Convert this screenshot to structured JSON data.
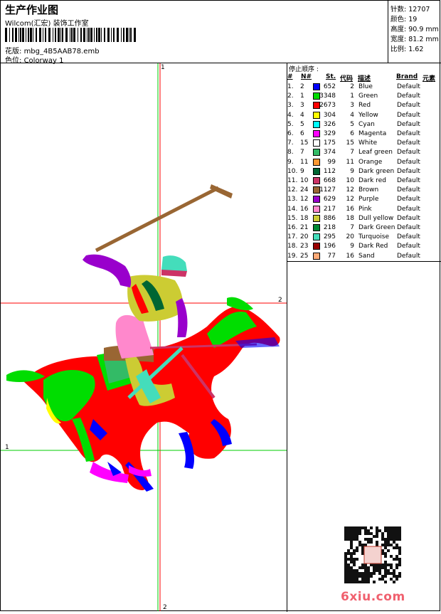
{
  "header": {
    "title": "生产作业图",
    "company": "Wilcom(汇宏) 装饰工作室",
    "design_label": "花版:",
    "design_file": "mbg_4B5AAB78.emb",
    "colorway_label": "色位:",
    "colorway": "Colorway 1"
  },
  "stats": {
    "stitches": "针数: 12707",
    "colors": "颜色: 19",
    "height": "高度: 90.9 mm",
    "width": "宽度: 81.2 mm",
    "scale": "比例: 1.62"
  },
  "guides": {
    "v1": "1",
    "h2": "2",
    "h1": "1",
    "v2": "2"
  },
  "table": {
    "caption": "停止顺序 :",
    "headers": {
      "num": "#",
      "needle": "N#",
      "st": "St.",
      "code": "代码",
      "desc": "描述",
      "brand": "Brand",
      "element": "元素"
    },
    "rows": [
      {
        "num": "1.",
        "needle": "2",
        "color": "#0000ff",
        "st": "652",
        "code": "2",
        "desc": "Blue",
        "brand": "Default"
      },
      {
        "num": "2.",
        "needle": "1",
        "color": "#00dd00",
        "st": "3348",
        "code": "1",
        "desc": "Green",
        "brand": "Default"
      },
      {
        "num": "3.",
        "needle": "3",
        "color": "#ff0000",
        "st": "2673",
        "code": "3",
        "desc": "Red",
        "brand": "Default"
      },
      {
        "num": "4.",
        "needle": "4",
        "color": "#ffff00",
        "st": "304",
        "code": "4",
        "desc": "Yellow",
        "brand": "Default"
      },
      {
        "num": "5.",
        "needle": "5",
        "color": "#00ffff",
        "st": "326",
        "code": "5",
        "desc": "Cyan",
        "brand": "Default"
      },
      {
        "num": "6.",
        "needle": "6",
        "color": "#ff00ff",
        "st": "329",
        "code": "6",
        "desc": "Magenta",
        "brand": "Default"
      },
      {
        "num": "7.",
        "needle": "15",
        "color": "#ffffff",
        "st": "175",
        "code": "15",
        "desc": "White",
        "brand": "Default"
      },
      {
        "num": "8.",
        "needle": "7",
        "color": "#33bb66",
        "st": "374",
        "code": "7",
        "desc": "Leaf green",
        "brand": "Default"
      },
      {
        "num": "9.",
        "needle": "11",
        "color": "#ff9933",
        "st": "99",
        "code": "11",
        "desc": "Orange",
        "brand": "Default"
      },
      {
        "num": "10.",
        "needle": "9",
        "color": "#006633",
        "st": "112",
        "code": "9",
        "desc": "Dark green",
        "brand": "Default"
      },
      {
        "num": "11.",
        "needle": "10",
        "color": "#cc3366",
        "st": "668",
        "code": "10",
        "desc": "Dark red",
        "brand": "Default"
      },
      {
        "num": "12.",
        "needle": "24",
        "color": "#996633",
        "st": "1127",
        "code": "12",
        "desc": "Brown",
        "brand": "Default"
      },
      {
        "num": "13.",
        "needle": "12",
        "color": "#9900cc",
        "st": "629",
        "code": "12",
        "desc": "Purple",
        "brand": "Default"
      },
      {
        "num": "14.",
        "needle": "16",
        "color": "#ff88cc",
        "st": "217",
        "code": "16",
        "desc": "Pink",
        "brand": "Default"
      },
      {
        "num": "15.",
        "needle": "18",
        "color": "#cccc33",
        "st": "886",
        "code": "18",
        "desc": "Dull yellow",
        "brand": "Default"
      },
      {
        "num": "16.",
        "needle": "21",
        "color": "#008833",
        "st": "218",
        "code": "7",
        "desc": "Dark Green",
        "brand": "Default"
      },
      {
        "num": "17.",
        "needle": "20",
        "color": "#44ddbb",
        "st": "295",
        "code": "20",
        "desc": "Turquoise",
        "brand": "Default"
      },
      {
        "num": "18.",
        "needle": "23",
        "color": "#990000",
        "st": "196",
        "code": "9",
        "desc": "Dark Red",
        "brand": "Default"
      },
      {
        "num": "19.",
        "needle": "25",
        "color": "#ffaa77",
        "st": "77",
        "code": "16",
        "desc": "Sand",
        "brand": "Default"
      }
    ]
  },
  "watermark": {
    "text": "6xiu.com",
    "icon": "qr-code-icon"
  }
}
